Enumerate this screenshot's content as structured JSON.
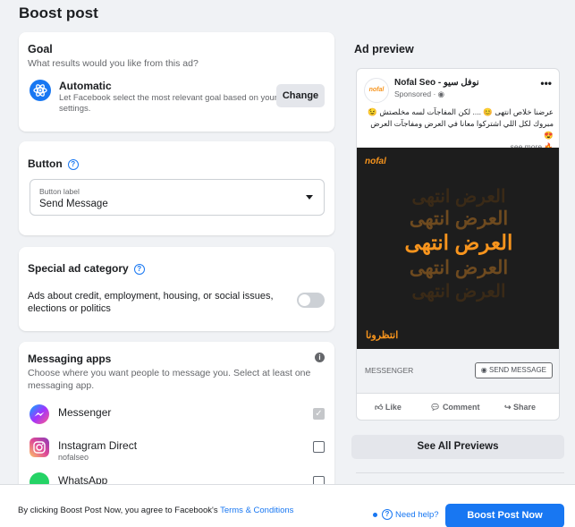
{
  "page": {
    "title": "Boost post"
  },
  "goal": {
    "heading": "Goal",
    "subheading": "What results would you like from this ad?",
    "option_title": "Automatic",
    "option_desc": "Let Facebook select the most relevant goal based on your settings.",
    "change_label": "Change",
    "icon": "atom-icon"
  },
  "button_section": {
    "heading": "Button",
    "field_label": "Button label",
    "field_value": "Send Message"
  },
  "special": {
    "heading": "Special ad category",
    "text": "Ads about credit, employment, housing, or social issues, elections or politics",
    "toggle_on": false
  },
  "messaging": {
    "heading": "Messaging apps",
    "subheading": "Choose where you want people to message you. Select at least one messaging app.",
    "apps": [
      {
        "name": "Messenger",
        "sub": "",
        "checked": true,
        "disabled": true,
        "icon": "messenger-icon"
      },
      {
        "name": "Instagram Direct",
        "sub": "nofalseo",
        "checked": false,
        "icon": "instagram-icon"
      },
      {
        "name": "WhatsApp",
        "sub": "",
        "checked": false,
        "icon": "whatsapp-icon"
      }
    ]
  },
  "preview": {
    "title": "Ad preview",
    "page_name": "Nofal Seo - نوفل سيو",
    "sponsored": "Sponsored · ",
    "avatar_text": "nofal",
    "body_line1": "عرضنا خلاص انتهى 😊 .... لكن المفاجآت لسه مخلصتش 😉",
    "body_line2": "مبروك لكل اللي اشتركوا معانا في العرض ومفاجآت العرض 😍",
    "body_line3": "see more...",
    "image_brand": "nofal",
    "image_lines": [
      "العرض انتهى",
      "العرض انتهى",
      "العرض انتهى",
      "العرض انتهى",
      "العرض انتهى"
    ],
    "image_tagline": "انتظرونا",
    "cta_left": "MESSENGER",
    "cta_button": "SEND MESSAGE",
    "actions": [
      "Like",
      "Comment",
      "Share"
    ]
  },
  "see_all": "See All Previews",
  "footer": {
    "agree_text": "By clicking Boost Post Now, you agree to Facebook's ",
    "terms": "Terms & Conditions",
    "help": "Need help?",
    "boost": "Boost Post Now"
  },
  "colors": {
    "accent": "#1877f2",
    "orange": "#f7941d",
    "image_bg": "#1d1d1d"
  }
}
